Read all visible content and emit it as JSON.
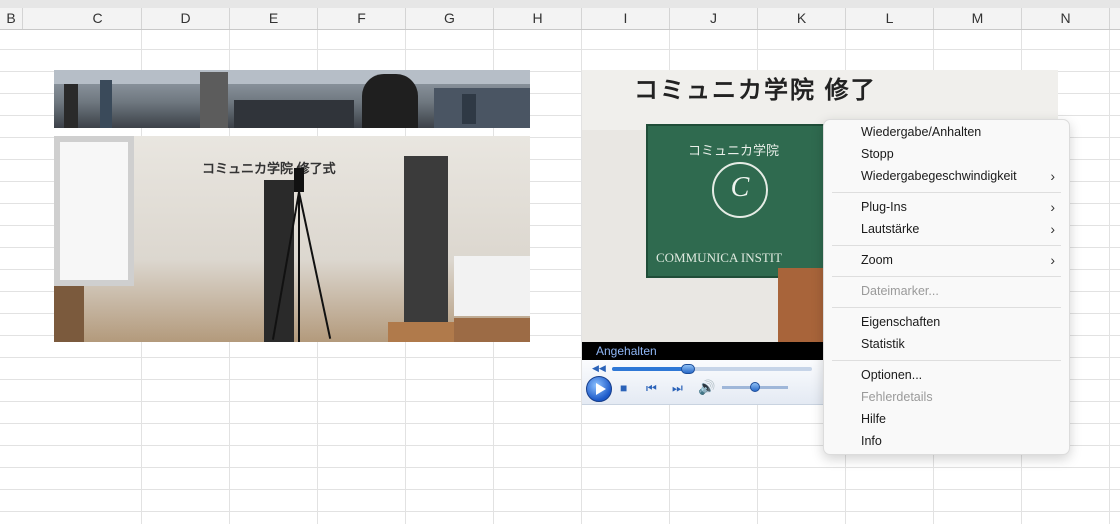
{
  "columns": [
    "B",
    "C",
    "D",
    "E",
    "F",
    "G",
    "H",
    "I",
    "J",
    "K",
    "L",
    "M",
    "N"
  ],
  "video": {
    "banner_text": "コミュニカ学院 修了",
    "flag_text": "コミュニカ学院",
    "seal_letter": "C",
    "institute_text": "COMMUNICA INSTIT",
    "status": "Angehalten"
  },
  "player": {
    "seek_progress": 0.38,
    "volume_level": 0.5
  },
  "photo_text": {
    "banner_text": "コミュニカ学院 修了式"
  },
  "context_menu": {
    "items": [
      {
        "label": "Wiedergabe/Anhalten",
        "submenu": false,
        "disabled": false
      },
      {
        "label": "Stopp",
        "submenu": false,
        "disabled": false
      },
      {
        "label": "Wiedergabegeschwindigkeit",
        "submenu": true,
        "disabled": false
      },
      {
        "label": "Plug-Ins",
        "submenu": true,
        "disabled": false
      },
      {
        "label": "Lautstärke",
        "submenu": true,
        "disabled": false
      },
      {
        "label": "Zoom",
        "submenu": true,
        "disabled": false
      },
      {
        "label": "Dateimarker...",
        "submenu": false,
        "disabled": true
      },
      {
        "label": "Eigenschaften",
        "submenu": false,
        "disabled": false
      },
      {
        "label": "Statistik",
        "submenu": false,
        "disabled": false
      },
      {
        "label": "Optionen...",
        "submenu": false,
        "disabled": false
      },
      {
        "label": "Fehlerdetails",
        "submenu": false,
        "disabled": true
      },
      {
        "label": "Hilfe",
        "submenu": false,
        "disabled": false
      },
      {
        "label": "Info",
        "submenu": false,
        "disabled": false
      }
    ],
    "submenu_arrow": "›"
  }
}
